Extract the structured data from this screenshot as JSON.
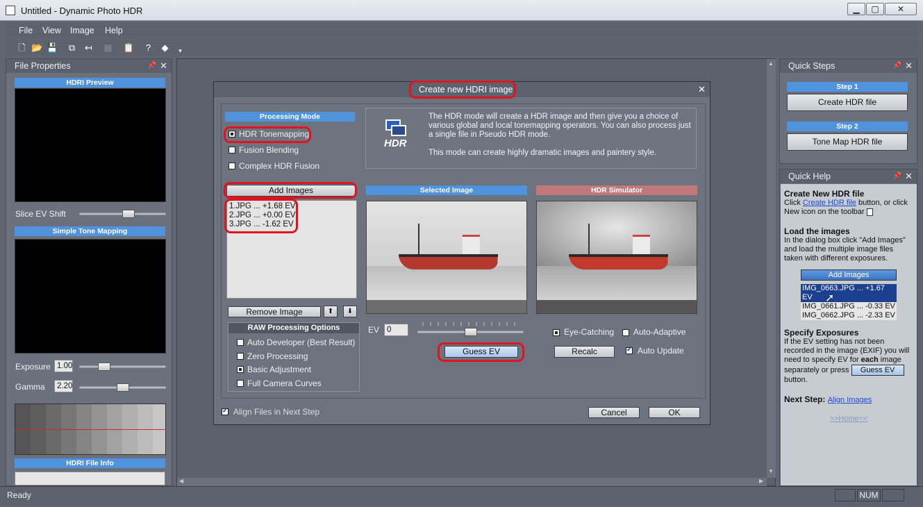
{
  "window": {
    "title": "Untitled - Dynamic Photo HDR",
    "min": "▁",
    "max": "▢",
    "close": "✕"
  },
  "menu": [
    "File",
    "View",
    "Image",
    "Help"
  ],
  "toolbar_icons": [
    "new-icon",
    "open-icon",
    "save-icon",
    "batch-icon",
    "undo-icon",
    "disabled-icon",
    "clipboard-icon",
    "help-icon",
    "eraser-icon"
  ],
  "file_properties": {
    "title": "File Properties",
    "hdri_preview": "HDRI Preview",
    "slice_ev_shift": "Slice EV Shift",
    "slice_ev_fraction": 0.58,
    "simple_tone_mapping": "Simple Tone Mapping",
    "exposure_label": "Exposure",
    "exposure_value": "1.00",
    "exposure_fraction": 0.25,
    "gamma_label": "Gamma",
    "gamma_value": "2.20",
    "gamma_fraction": 0.5,
    "hdri_file_info": "HDRI File Info"
  },
  "dialog": {
    "title": "Create new HDRI image",
    "processing_mode": "Processing  Mode",
    "modes": [
      "HDR Tonemapping",
      "Fusion Blending",
      "Complex HDR Fusion"
    ],
    "selected_mode": 0,
    "hdr_logo_text": "HDR",
    "description_1": "The HDR mode will create a HDR image and then give you a choice of various global and local tonemapping operators. You can also process just a single file in Pseudo HDR mode.",
    "description_2": "This mode can create highly dramatic images and paintery style.",
    "add_images": "Add Images",
    "files": [
      "1.JPG ... +1.68 EV",
      "2.JPG ... +0.00 EV",
      "3.JPG ... -1.62 EV"
    ],
    "remove_image": "Remove Image",
    "raw_options_title": "RAW Processing Options",
    "raw_options": [
      "Auto Developer (Best Result)",
      "Zero Processing",
      "Basic Adjustment",
      "Full Camera Curves"
    ],
    "raw_selected": 2,
    "selected_image": "Selected Image",
    "hdr_simulator": "HDR Simulator",
    "ev_label": "EV",
    "ev_value": "0",
    "ev_fraction": 0.5,
    "guess_ev": "Guess EV",
    "eye_catching": "Eye-Catching",
    "auto_adaptive": "Auto-Adaptive",
    "recalc": "Recalc",
    "auto_update": "Auto Update",
    "align_files": "Align Files in Next Step",
    "cancel": "Cancel",
    "ok": "OK"
  },
  "quick_steps": {
    "title": "Quick Steps",
    "step1": "Step 1",
    "step1_button": "Create HDR file",
    "step2": "Step 2",
    "step2_button": "Tone Map HDR file"
  },
  "quick_help": {
    "title": "Quick Help",
    "h1": "Create New HDR file",
    "p1_a": "Click ",
    "p1_link": "Create HDR file",
    "p1_b": " button, or click New icon on the toolbar",
    "h2": "Load the images",
    "p2": "In the dialog box click \"Add Images\" and load the multiple image files taken with different exposures.",
    "add_images": "Add Images",
    "files": [
      "IMG_0663.JPG ... +1.67 EV",
      "IMG_0661.JPG ... -0.33 EV",
      "IMG_0662.JPG ... -2.33 EV"
    ],
    "h3": "Specify Exposures",
    "p3_a": "If the EV setting has not been recorded in the image (EXIF) you will need to specify EV for ",
    "p3_bold": "each",
    "p3_b": " image separately or press",
    "guess_ev": "Guess EV",
    "p3_c": "button.",
    "next_step_label": "Next Step:",
    "next_step_link": "Align Images",
    "home": ">>Home<<"
  },
  "status": {
    "text": "Ready",
    "num": "NUM"
  }
}
